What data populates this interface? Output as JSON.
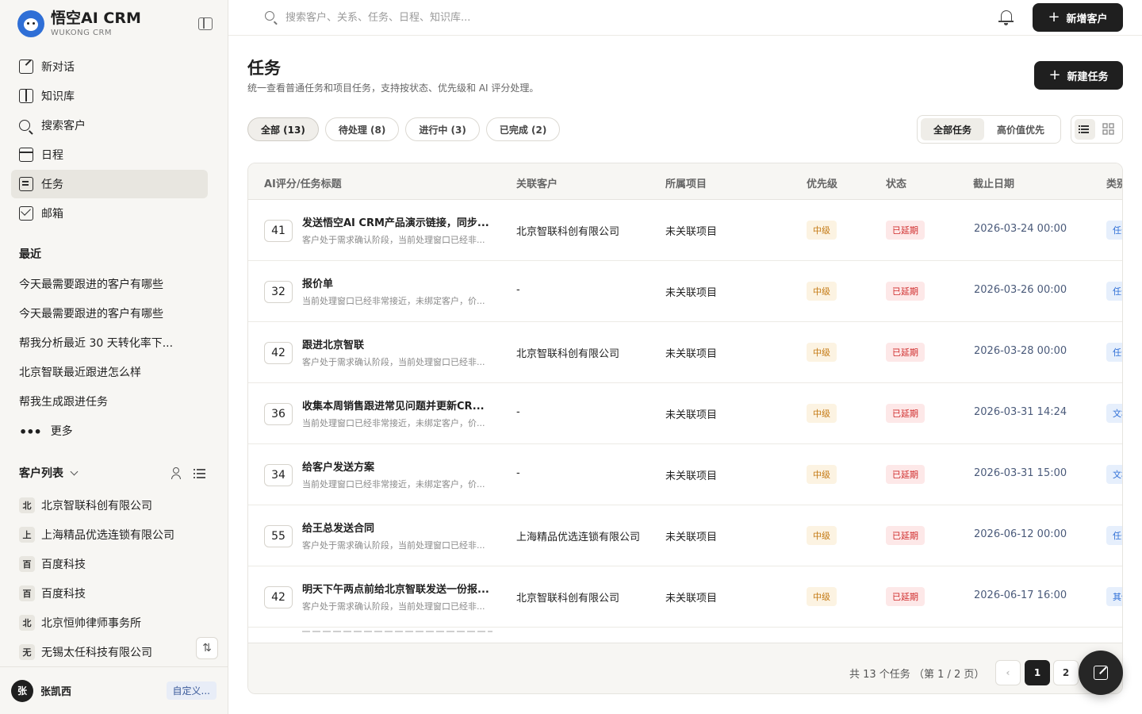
{
  "brand": {
    "title": "悟空AI CRM",
    "subtitle": "WUKONG CRM"
  },
  "nav": [
    {
      "label": "新对话",
      "icon": "edit-icon"
    },
    {
      "label": "知识库",
      "icon": "book-icon"
    },
    {
      "label": "搜索客户",
      "icon": "search-icon"
    },
    {
      "label": "日程",
      "icon": "calendar-icon"
    },
    {
      "label": "任务",
      "icon": "task-icon",
      "active": true
    },
    {
      "label": "邮箱",
      "icon": "mail-icon"
    }
  ],
  "recent": {
    "label": "最近",
    "items": [
      "今天最需要跟进的客户有哪些",
      "今天最需要跟进的客户有哪些",
      "帮我分析最近 30 天转化率下...",
      "北京智联最近跟进怎么样",
      "帮我生成跟进任务"
    ],
    "more": "更多"
  },
  "customers": {
    "label": "客户列表",
    "items": [
      {
        "badge": "北",
        "name": "北京智联科创有限公司"
      },
      {
        "badge": "上",
        "name": "上海精品优选连锁有限公司"
      },
      {
        "badge": "百",
        "name": "百度科技"
      },
      {
        "badge": "百",
        "name": "百度科技"
      },
      {
        "badge": "北",
        "name": "北京恒帅律师事务所"
      },
      {
        "badge": "无",
        "name": "无锡太任科技有限公司"
      }
    ]
  },
  "user": {
    "avatar": "张",
    "name": "张凯西",
    "tag": "自定义..."
  },
  "topbar": {
    "search_placeholder": "搜索客户、关系、任务、日程、知识库...",
    "add_customer": "新增客户"
  },
  "page": {
    "title": "任务",
    "subtitle": "统一查看普通任务和项目任务，支持按状态、优先级和 AI 评分处理。",
    "new_task": "新建任务"
  },
  "filters": [
    "全部 (13)",
    "待处理 (8)",
    "进行中 (3)",
    "已完成 (2)"
  ],
  "segments": [
    "全部任务",
    "高价值优先"
  ],
  "table": {
    "columns": [
      "AI评分/任务标题",
      "关联客户",
      "所属项目",
      "优先级",
      "状态",
      "截止日期",
      "类别"
    ],
    "rows": [
      {
        "score": "41",
        "title": "发送悟空AI CRM产品演示链接，同步...",
        "desc": "客户处于需求确认阶段，当前处理窗口已经非...",
        "customer": "北京智联科创有限公司",
        "project": "未关联项目",
        "priority": "中级",
        "status": "已延期",
        "due": "2026-03-24 00:00",
        "category": "任务"
      },
      {
        "score": "32",
        "title": "报价单",
        "desc": "当前处理窗口已经非常接近，未绑定客户，价...",
        "customer": "-",
        "project": "未关联项目",
        "priority": "中级",
        "status": "已延期",
        "due": "2026-03-26 00:00",
        "category": "任务"
      },
      {
        "score": "42",
        "title": "跟进北京智联",
        "desc": "客户处于需求确认阶段，当前处理窗口已经非...",
        "customer": "北京智联科创有限公司",
        "project": "未关联项目",
        "priority": "中级",
        "status": "已延期",
        "due": "2026-03-28 00:00",
        "category": "任务"
      },
      {
        "score": "36",
        "title": "收集本周销售跟进常见问题并更新CR...",
        "desc": "当前处理窗口已经非常接近，未绑定客户，价...",
        "customer": "-",
        "project": "未关联项目",
        "priority": "中级",
        "status": "已延期",
        "due": "2026-03-31 14:24",
        "category": "文档"
      },
      {
        "score": "34",
        "title": "给客户发送方案",
        "desc": "当前处理窗口已经非常接近，未绑定客户，价...",
        "customer": "-",
        "project": "未关联项目",
        "priority": "中级",
        "status": "已延期",
        "due": "2026-03-31 15:00",
        "category": "文档"
      },
      {
        "score": "55",
        "title": "给王总发送合同",
        "desc": "客户处于需求确认阶段，当前处理窗口已经非...",
        "customer": "上海精品优选连锁有限公司",
        "project": "未关联项目",
        "priority": "中级",
        "status": "已延期",
        "due": "2026-06-12 00:00",
        "category": "任务"
      },
      {
        "score": "42",
        "title": "明天下午两点前给北京智联发送一份报...",
        "desc": "客户处于需求确认阶段，当前处理窗口已经非...",
        "customer": "北京智联科创有限公司",
        "project": "未关联项目",
        "priority": "中级",
        "status": "已延期",
        "due": "2026-06-17 16:00",
        "category": "其他"
      }
    ]
  },
  "pagination": {
    "summary": "共 13 个任务 （第 1 / 2 页）",
    "pages": [
      "1",
      "2"
    ]
  },
  "colors": {
    "accent": "#1f1f1f",
    "priority": "#c47a14",
    "status_overdue": "#d02c2c",
    "category": "#2f6fd6"
  }
}
